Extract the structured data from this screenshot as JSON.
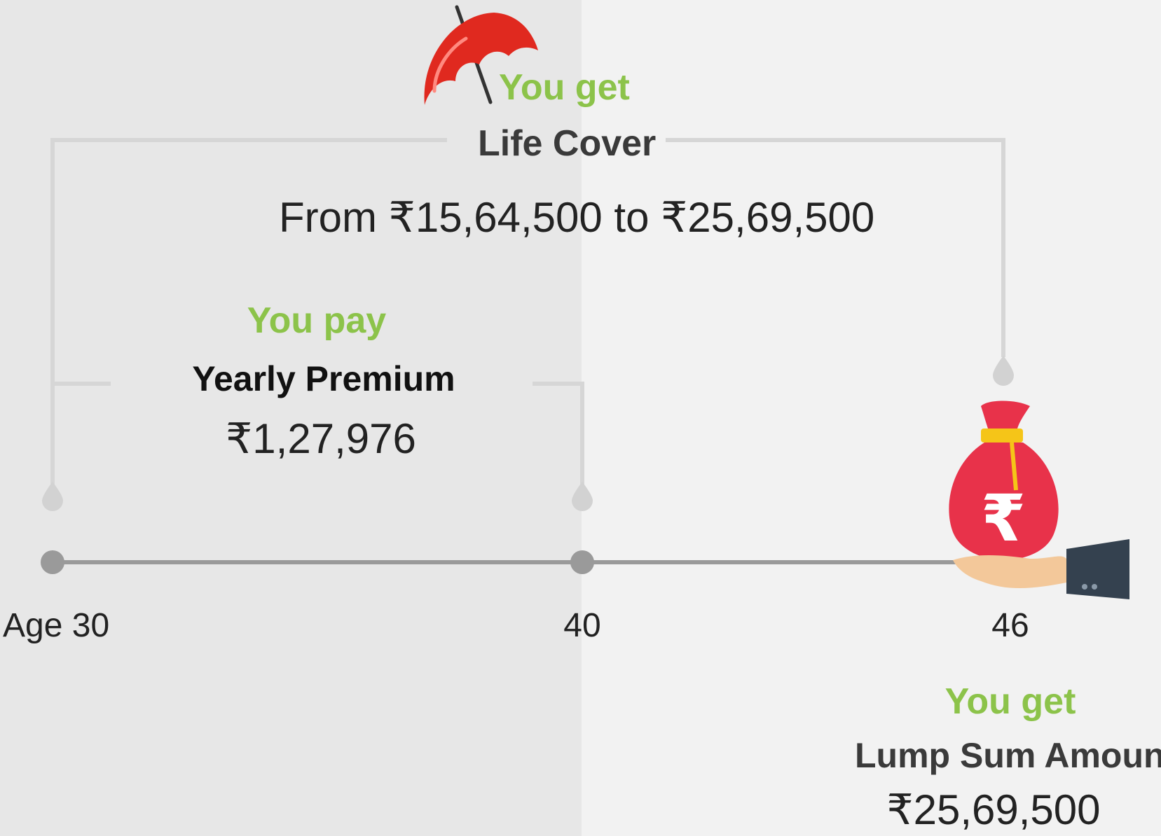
{
  "life_cover": {
    "eyebrow": "You get",
    "title": "Life Cover",
    "range": "From ₹15,64,500 to ₹25,69,500"
  },
  "premium": {
    "eyebrow": "You pay",
    "title": "Yearly Premium",
    "amount": "₹1,27,976"
  },
  "maturity": {
    "eyebrow": "You get",
    "title": "Lump Sum Amount",
    "amount": "₹25,69,500"
  },
  "timeline": {
    "start_label": "Age 30",
    "mid_label": "40",
    "end_label": "46"
  },
  "icons": {
    "cover": "umbrella-icon",
    "payout": "money-bag-hand-icon"
  },
  "colors": {
    "accent_green": "#8cc34a",
    "umbrella_red": "#e0291f",
    "bag_red": "#e8324a",
    "line_grey": "#d6d6d6",
    "axis_grey": "#9a9a9a"
  }
}
